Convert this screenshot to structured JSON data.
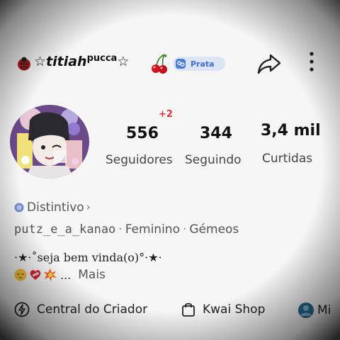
{
  "header": {
    "username_prefix": "☆titiah",
    "username_sup": "pucca",
    "username_suffix": "☆",
    "badge_label": "Prata",
    "icons": [
      "ladybug-icon",
      "cherry-icon",
      "badge-medal-icon",
      "share-icon",
      "more-vertical-icon"
    ]
  },
  "stats": {
    "new_followers": "+2",
    "followers_value": "556",
    "followers_label": "Seguidores",
    "following_value": "344",
    "following_label": "Seguindo",
    "likes_value": "3,4 mil",
    "likes_label": "Curtidas"
  },
  "profile": {
    "distintivo_label": "Distintivo",
    "handle": "putz_e_a_kanao",
    "gender": "Feminino",
    "sign": "Gémeos",
    "bio_line1": "·★·˚seja bem vinda(o)°·★·",
    "bio_more_ellipsis": "...",
    "more_label": "Mais"
  },
  "bottom_bar": {
    "creator_center_label": "Central do Criador",
    "kwai_shop_label": "Kwai Shop",
    "third_label": "Mi"
  },
  "colors": {
    "badge_bg": "#dbe5f6",
    "badge_text": "#3f6fc9",
    "new_followers": "#e03040"
  }
}
